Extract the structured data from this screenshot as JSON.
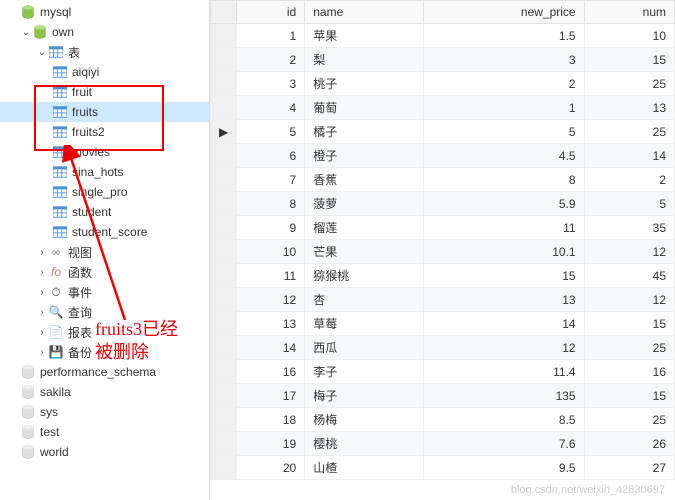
{
  "sidebar": {
    "db_mysql": "mysql",
    "db_own": "own",
    "folder_tables": "表",
    "tables": [
      "aiqiyi",
      "fruit",
      "fruits",
      "fruits2",
      "movies",
      "sina_hots",
      "single_pro",
      "student",
      "student_score"
    ],
    "folder_views": "视图",
    "folder_functions": "函数",
    "folder_events": "事件",
    "folder_queries": "查询",
    "folder_reports": "报表",
    "folder_backups": "备份",
    "db_perf": "performance_schema",
    "db_sakila": "sakila",
    "db_sys": "sys",
    "db_test": "test",
    "db_world": "world"
  },
  "grid": {
    "columns": [
      "id",
      "name",
      "new_price",
      "num"
    ],
    "rows": [
      {
        "id": 1,
        "name": "苹果",
        "new_price": "1.5",
        "num": 10
      },
      {
        "id": 2,
        "name": "梨",
        "new_price": "3",
        "num": 15
      },
      {
        "id": 3,
        "name": "桃子",
        "new_price": "2",
        "num": 25
      },
      {
        "id": 4,
        "name": "葡萄",
        "new_price": "1",
        "num": 13
      },
      {
        "id": 5,
        "name": "橘子",
        "new_price": "5",
        "num": 25
      },
      {
        "id": 6,
        "name": "橙子",
        "new_price": "4.5",
        "num": 14
      },
      {
        "id": 7,
        "name": "香蕉",
        "new_price": "8",
        "num": 2
      },
      {
        "id": 8,
        "name": "菠萝",
        "new_price": "5.9",
        "num": 5
      },
      {
        "id": 9,
        "name": "榴莲",
        "new_price": "11",
        "num": 35
      },
      {
        "id": 10,
        "name": "芒果",
        "new_price": "10.1",
        "num": 12
      },
      {
        "id": 11,
        "name": "猕猴桃",
        "new_price": "15",
        "num": 45
      },
      {
        "id": 12,
        "name": "杏",
        "new_price": "13",
        "num": 12
      },
      {
        "id": 13,
        "name": "草莓",
        "new_price": "14",
        "num": 15
      },
      {
        "id": 14,
        "name": "西瓜",
        "new_price": "12",
        "num": 25
      },
      {
        "id": 16,
        "name": "李子",
        "new_price": "11.4",
        "num": 16
      },
      {
        "id": 17,
        "name": "梅子",
        "new_price": "135",
        "num": 15
      },
      {
        "id": 18,
        "name": "杨梅",
        "new_price": "8.5",
        "num": 25
      },
      {
        "id": 19,
        "name": "樱桃",
        "new_price": "7.6",
        "num": 26
      },
      {
        "id": 20,
        "name": "山楂",
        "new_price": "9.5",
        "num": 27
      }
    ],
    "current_row_index": 4
  },
  "annotation": {
    "line1": "fruits3已经",
    "line2": "被删除"
  },
  "watermark": "blog.csdn.net/weixin_42830697"
}
